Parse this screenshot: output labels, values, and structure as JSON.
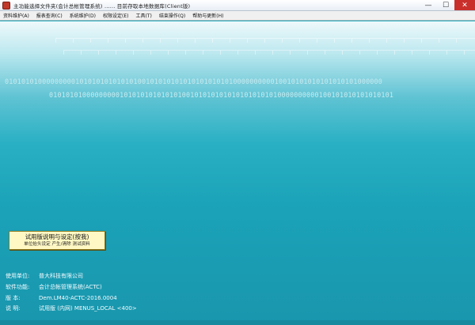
{
  "window": {
    "title": "主功能选择文件夹(会计总帐管理系统) ......  目前存取本地数据库(Client版)",
    "minimize_glyph": "—",
    "maximize_glyph": "☐",
    "close_glyph": "✕"
  },
  "menu": [
    {
      "label": "资料维护(A)"
    },
    {
      "label": "报表查询(C)"
    },
    {
      "label": "系统维护(D)"
    },
    {
      "label": "权限设定(E)"
    },
    {
      "label": "工具(T)"
    },
    {
      "label": "结束操作(Q)"
    },
    {
      "label": "帮助与更新(H)"
    }
  ],
  "background": {
    "binary_line_1": "0101010100000000010101010101010100101010101010101010101000000000010010101010101010101000000",
    "binary_line_2": "01010101000000000101010101010101001010101010101010101010000000000100101010101010101"
  },
  "trial_button": {
    "title": "试用版说明与设定(按我)",
    "subtitle": "单位抬头设定  产生/清除  测试资料"
  },
  "info": {
    "unit_label": "使用单位:",
    "unit_value": "普大科技有限公司",
    "function_label": "软件功能:",
    "function_value": "会计总帐管理系统(ACTC)",
    "version_label": "版    本:",
    "version_value": "Dem.LM40-ACTC-2016.0004",
    "note_label": "说    明:",
    "note_value": "试用版 (内网) MENUS_LOCAL <400>"
  },
  "colors": {
    "background_top": "#eef9fb",
    "background_main": "#1ba3b9",
    "trial_button_bg": "#fff8c4",
    "close_button": "#c9302c"
  }
}
